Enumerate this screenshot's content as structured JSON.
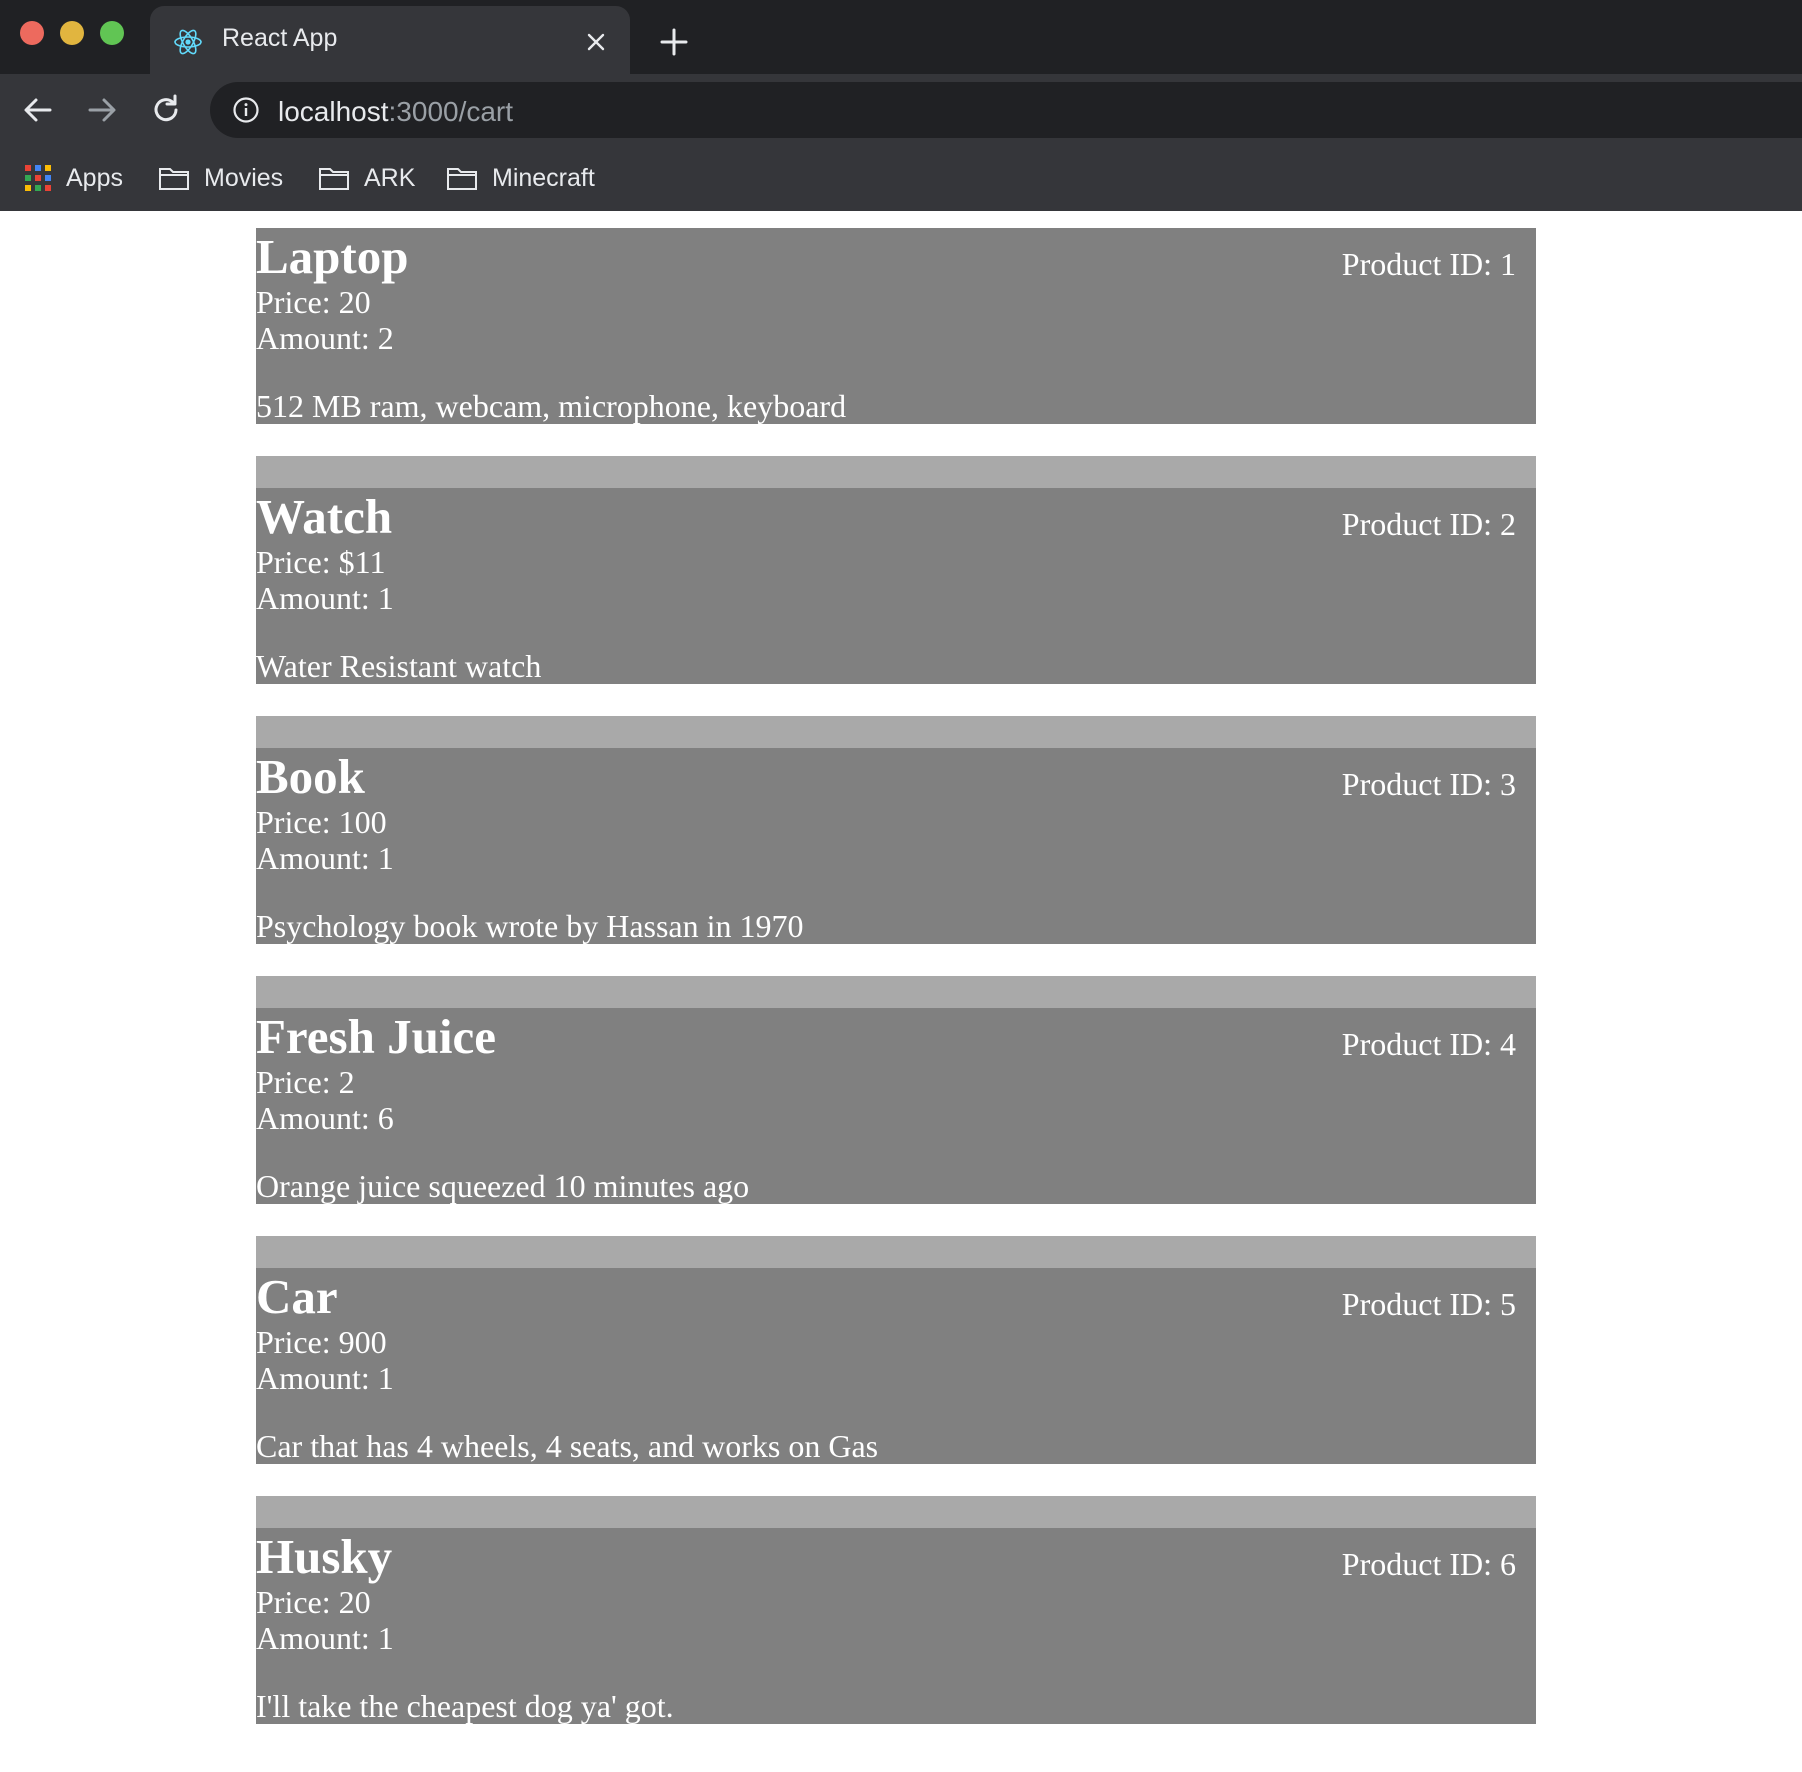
{
  "browser": {
    "tab_title": "React App",
    "url_host": "localhost",
    "url_path": ":3000/cart",
    "bookmarks": [
      {
        "label": "Apps"
      },
      {
        "label": "Movies"
      },
      {
        "label": "ARK"
      },
      {
        "label": "Minecraft"
      }
    ]
  },
  "cart": {
    "products": [
      {
        "name": "Laptop",
        "id_text": "Product ID: 1",
        "price_text": "Price: 20",
        "amount_text": "Amount: 2",
        "description": "512 MB ram, webcam, microphone, keyboard"
      },
      {
        "name": "Watch",
        "id_text": "Product ID: 2",
        "price_text": "Price: $11",
        "amount_text": "Amount: 1",
        "description": "Water Resistant watch"
      },
      {
        "name": "Book",
        "id_text": "Product ID: 3",
        "price_text": "Price: 100",
        "amount_text": "Amount: 1",
        "description": "Psychology book wrote by Hassan in 1970"
      },
      {
        "name": "Fresh Juice",
        "id_text": "Product ID: 4",
        "price_text": "Price: 2",
        "amount_text": "Amount: 6",
        "description": "Orange juice squeezed 10 minutes ago"
      },
      {
        "name": "Car",
        "id_text": "Product ID: 5",
        "price_text": "Price: 900",
        "amount_text": "Amount: 1",
        "description": "Car that has 4 wheels, 4 seats, and works on Gas"
      },
      {
        "name": "Husky",
        "id_text": "Product ID: 6",
        "price_text": "Price: 20",
        "amount_text": "Amount: 1",
        "description": "I'll take the cheapest dog ya' got."
      }
    ]
  },
  "colors": {
    "card_bg": "#808080",
    "gap_bg": "#a9a9a9",
    "chrome_dark": "#202124",
    "chrome_toolbar": "#35363a"
  }
}
